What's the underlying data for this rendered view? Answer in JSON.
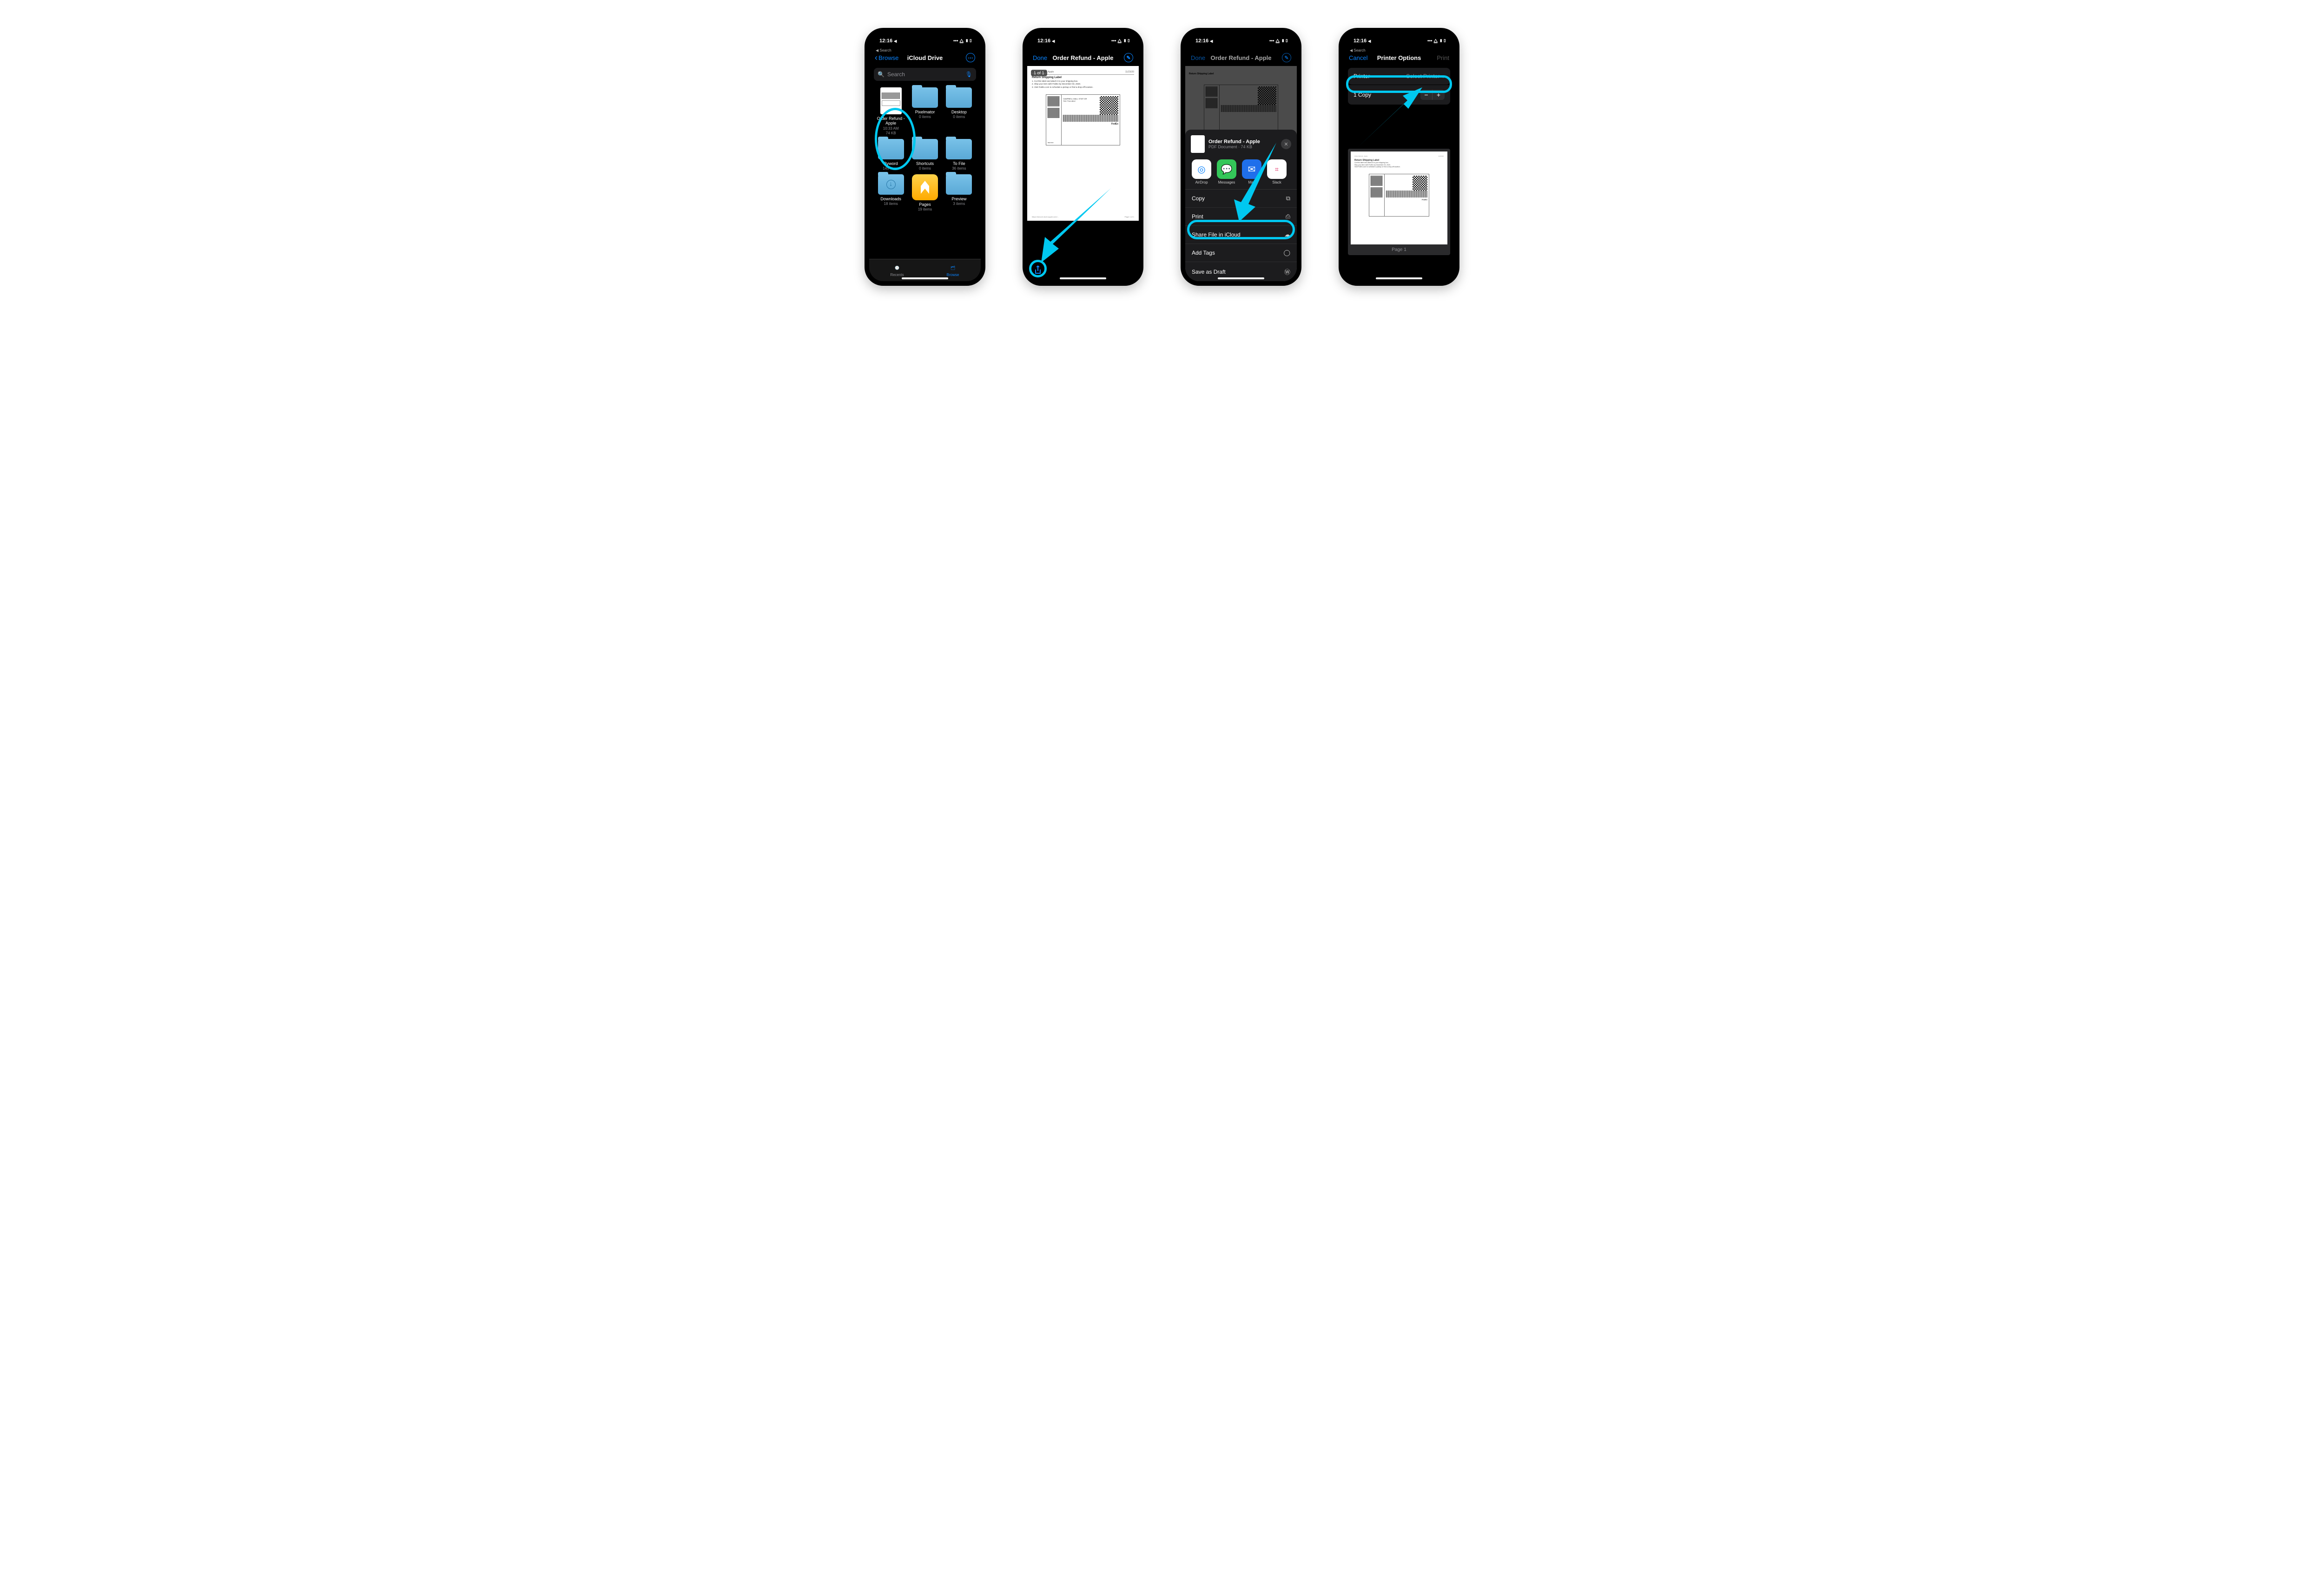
{
  "statusbar": {
    "time": "12:16",
    "loc_icon": "◀",
    "signal": "▮▮▮▮",
    "wifi": "◉",
    "batt": "▮▯"
  },
  "back_search": "◀ Search",
  "phone1": {
    "nav_back": "Browse",
    "title": "iCloud Drive",
    "search_ph": "Search",
    "items": [
      {
        "name": "Order Refund - Apple",
        "meta1": "10:33 AM",
        "meta2": "74 KB",
        "type": "doc"
      },
      {
        "name": "Pixelmator",
        "meta1": "0 items",
        "type": "folder"
      },
      {
        "name": "Desktop",
        "meta1": "0 items",
        "type": "folder"
      },
      {
        "name": "Byword",
        "meta1": "145 items",
        "type": "folder"
      },
      {
        "name": "Shortcuts",
        "meta1": "0 items",
        "type": "folder"
      },
      {
        "name": "To File",
        "meta1": "36 items",
        "type": "folder"
      },
      {
        "name": "Downloads",
        "meta1": "18 items",
        "type": "folder-dl"
      },
      {
        "name": "Pages",
        "meta1": "19 items",
        "type": "pages"
      },
      {
        "name": "Preview",
        "meta1": "3 items",
        "type": "folder"
      }
    ],
    "tabs": {
      "recents": "Recents",
      "browse": "Browse"
    }
  },
  "phone2": {
    "done": "Done",
    "title": "Order Refund - Apple",
    "page_indicator": "1 of 1",
    "doc": {
      "header_l": "Order Refund - Apple",
      "header_r": "11/23/20",
      "title": "Return Shipping Label",
      "steps": [
        "1. Cut this label and attach it to your shipping box.",
        "2. Ship your item with FedEx by December 03, 2020.",
        "3. Visit FedEx.com to schedule a pickup or find a drop-off location."
      ],
      "foot_l": "https://secure.store.apple.com/...",
      "foot_r": "Page 1 of 1"
    }
  },
  "phone3": {
    "done": "Done",
    "title": "Order Refund - Apple",
    "sheet": {
      "name": "Order Refund - Apple",
      "sub": "PDF Document · 74 KB",
      "apps": [
        {
          "label": "AirDrop",
          "bg": "#fff",
          "fg": "#0a84ff",
          "glyph": "◎"
        },
        {
          "label": "Messages",
          "bg": "#34c759",
          "fg": "#fff",
          "glyph": "✉"
        },
        {
          "label": "Mail",
          "bg": "#1f6feb",
          "fg": "#fff",
          "glyph": "✉"
        },
        {
          "label": "Slack",
          "bg": "#fff",
          "fg": "#611f69",
          "glyph": "⌗"
        }
      ],
      "actions": [
        {
          "label": "Copy",
          "icon": "⧉"
        },
        {
          "label": "Print",
          "icon": "⎙"
        },
        {
          "label": "Share File in iCloud",
          "icon": "☁"
        },
        {
          "label": "Add Tags",
          "icon": "◯"
        },
        {
          "label": "Save as Draft",
          "icon": "Ⓦ"
        }
      ]
    }
  },
  "phone4": {
    "cancel": "Cancel",
    "title": "Printer Options",
    "print": "Print",
    "row_printer": {
      "label": "Printer",
      "value": "Select Printer"
    },
    "row_copies": {
      "label": "1 Copy"
    },
    "preview": {
      "page_label": "Page 1",
      "label_title": "Return Shipping Label",
      "steps": [
        "Cut this label and attach it to your shipping box.",
        "Ship your item with FedEx by December 03, 2020.",
        "Visit FedEx.com to schedule a pickup or find a drop-off location."
      ]
    }
  }
}
